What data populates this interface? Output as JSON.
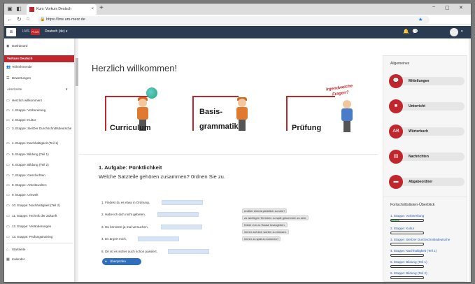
{
  "browser": {
    "tab_title": "Kurs: Vorkurs Deutsch",
    "tab_close": "×",
    "new_tab": "+",
    "url": "https://lms.um-merz.de",
    "win_min": "−",
    "win_max": "▢",
    "win_close": "✕"
  },
  "topbar": {
    "menu_icon": "≡",
    "lms": "LMS",
    "plus": "PLUS",
    "language": "Deutsch (de) ▾"
  },
  "sidebar": {
    "dashboard": "Dashboard",
    "course": "Vorkurs Deutsch",
    "participants": "Teilnehmende",
    "grades": "Bewertungen",
    "sections_header": "Abschnitte",
    "sections": [
      "Herzlich willkommen!",
      "1. Etappe: Vorbereitung",
      "2. Etappe: Kultur",
      "3. Etappe: Sie/Der Durchschnittsdeutsche",
      "4. Etappe: Nachhaltigkeit (Teil 1)",
      "5. Etappe: Bildung (Teil 1)",
      "6. Etappe: Bildung (Teil 2)",
      "7. Etappe: Geschichten",
      "8. Etappe: Arbeitswelten",
      "9. Etappe: Umwelt",
      "10. Etappe: Nachhaltigkeit (Teil 2)",
      "11. Etappe: Technik der Zukunft",
      "12. Etappe: Veränderungen",
      "13. Etappe: Prüfungstraining"
    ],
    "home": "Startseite",
    "calendar": "Kalender"
  },
  "main": {
    "welcome": "Herzlich willkommen!",
    "cards": {
      "curriculum": "Curriculum",
      "grammar_1": "Basis-",
      "grammar_2": "grammatik",
      "exam": "Prüfung",
      "exam_callout_1": "Irgendwelche",
      "exam_callout_2": "Fragen?"
    },
    "task_title": "1. Aufgabe: Pünktlichkeit",
    "task_subtitle": "Welche Satzteile gehören zusammen? 0rdnen Sie zu.",
    "sentences": [
      "1. Findest du es etwa in Ordnung,",
      "2. Habe ich dich nicht gebeten,",
      "3. Du könntest ja mal versuchen,",
      "4. Es ärgert mich,",
      "5. Dir ist es sicher auch schon passiert,"
    ],
    "answers": [
      "endlich einmal pünktlich zu sein?",
      "zu wichtigen Terminen zu spät gekommen zu sein.",
      "früher von zu Hause loszugehen.",
      "immer auf dich warten zu müssen.",
      "immer zu spät zu kommen?"
    ],
    "check_button": "Überprüfen"
  },
  "right": {
    "general_header": "Allgemeines",
    "links": [
      "Mitteilungen",
      "Unterricht",
      "Wörterbuch",
      "Nachrichten",
      "Abgabeordner"
    ],
    "progress_header": "Fortschrittslisten-Überblick",
    "progress": [
      {
        "label": "1. Etappe: Vorbereitung",
        "value": 0.25,
        "text": "Fortschritt"
      },
      {
        "label": "2. Etappe: Kultur",
        "value": 0
      },
      {
        "label": "3. Etappe: Sie/Der Durchschnittsdeutsche",
        "value": 0
      },
      {
        "label": "4. Etappe: Nachhaltigkeit (Teil 1)",
        "value": 0
      },
      {
        "label": "5. Etappe: Bildung (Teil 1)",
        "value": 0
      },
      {
        "label": "6. Etappe: Bildung (Teil 2)",
        "value": 0
      }
    ]
  }
}
